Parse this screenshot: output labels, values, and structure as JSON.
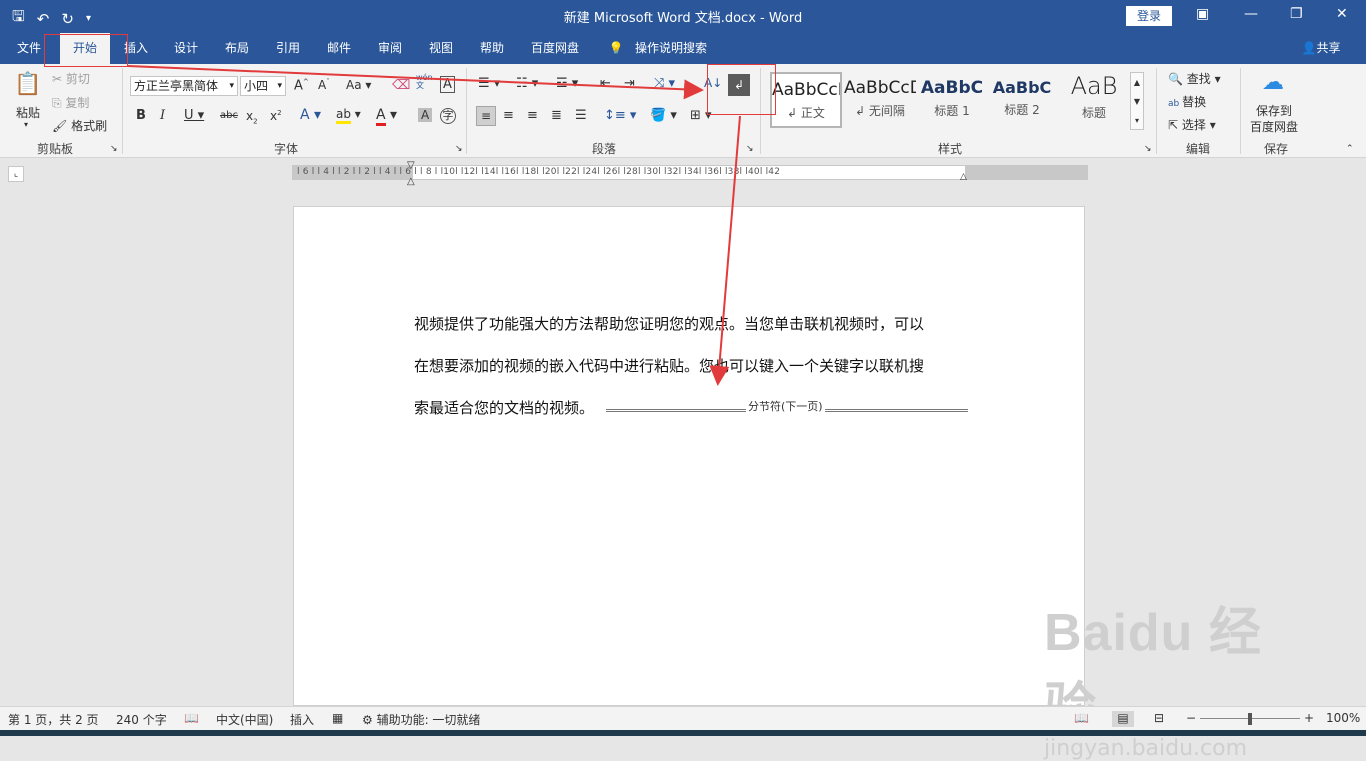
{
  "title_bar": {
    "doc_title": "新建 Microsoft Word 文档.docx  -  Word",
    "login": "登录",
    "qat": [
      "save-icon",
      "undo-icon",
      "redo-icon",
      "customize-icon"
    ]
  },
  "tabs": [
    "文件",
    "开始",
    "插入",
    "设计",
    "布局",
    "引用",
    "邮件",
    "审阅",
    "视图",
    "帮助",
    "百度网盘",
    "操作说明搜索"
  ],
  "share": "共享",
  "clipboard": {
    "paste": "粘贴",
    "cut": "剪切",
    "copy": "复制",
    "format_painter": "格式刷",
    "label": "剪贴板"
  },
  "font": {
    "name": "方正兰亭黑简体",
    "size": "小四",
    "label": "字体",
    "wen": "wén",
    "aa": "Aa"
  },
  "paragraph": {
    "label": "段落"
  },
  "styles": {
    "label": "样式",
    "items": [
      {
        "sample": "AaBbCcDc",
        "name": "正文"
      },
      {
        "sample": "AaBbCcDc",
        "name": "无间隔"
      },
      {
        "sample": "AaBbC",
        "name": "标题 1"
      },
      {
        "sample": "AaBbC",
        "name": "标题 2"
      },
      {
        "sample": "AaB",
        "name": "标题"
      }
    ]
  },
  "editing": {
    "find": "查找",
    "replace": "替换",
    "select": "选择",
    "label": "编辑"
  },
  "save_group": {
    "save_to": "保存到",
    "baidu": "百度网盘",
    "label": "保存"
  },
  "ruler_numbers": "l 6 l  l 4 l  l 2 l     l 2 l  l 4 l  l 6 l  l 8 l  l10l  l12l  l14l  l16l  l18l  l20l  l22l  l24l  l26l  l28l  l30l  l32l  l34l  l36l  l38l  l40l  l42",
  "document": {
    "lines": [
      "视频提供了功能强大的方法帮助您证明您的观点。当您单击联机视频时，可以",
      "在想要添加的视频的嵌入代码中进行粘贴。您也可以键入一个关键字以联机搜",
      "索最适合您的文档的视频。"
    ],
    "section_break": "分节符(下一页)"
  },
  "watermark": {
    "brand": "Baidu 经验",
    "url": "jingyan.baidu.com"
  },
  "status": {
    "page": "第 1 页，共 2 页",
    "words": "240 个字",
    "language": "中文(中国)",
    "mode": "插入",
    "accessibility": "辅助功能: 一切就绪",
    "zoom": "100%"
  },
  "colors": {
    "brand": "#2b579a",
    "annotation": "#e23b3b"
  }
}
